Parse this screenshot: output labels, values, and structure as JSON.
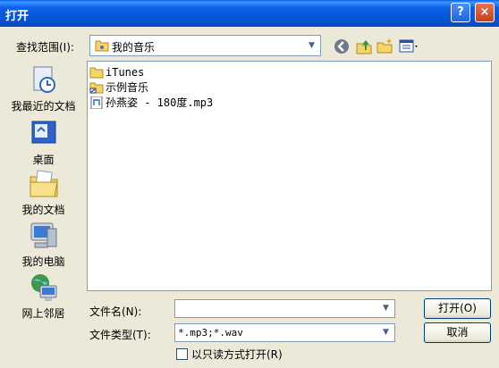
{
  "window": {
    "title": "打开",
    "help": "?",
    "close": "×"
  },
  "lookin": {
    "label": "查找范围(I):",
    "value": "我的音乐"
  },
  "places": [
    {
      "label": "我最近的文档",
      "icon": "recent-documents-icon"
    },
    {
      "label": "桌面",
      "icon": "desktop-icon"
    },
    {
      "label": "我的文档",
      "icon": "my-documents-icon"
    },
    {
      "label": "我的电脑",
      "icon": "my-computer-icon"
    },
    {
      "label": "网上邻居",
      "icon": "network-places-icon"
    }
  ],
  "files": [
    {
      "name": "iTunes",
      "type": "folder"
    },
    {
      "name": "示例音乐",
      "type": "folder-shortcut"
    },
    {
      "name": "孙燕姿 - 180度.mp3",
      "type": "mp3"
    }
  ],
  "filename": {
    "label": "文件名(N):",
    "value": ""
  },
  "filetype": {
    "label": "文件类型(T):",
    "value": "*.mp3;*.wav"
  },
  "buttons": {
    "open": "打开(O)",
    "cancel": "取消"
  },
  "readonly": {
    "label": "以只读方式打开(R)",
    "checked": false
  }
}
